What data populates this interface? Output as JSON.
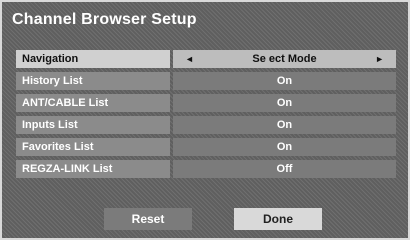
{
  "title": "Channel Browser Setup",
  "rows": [
    {
      "label": "Navigation",
      "value": "Se ect Mode",
      "left_arrow": "◄",
      "right_arrow": "►"
    },
    {
      "label": "History List",
      "value": "On"
    },
    {
      "label": "ANT/CABLE List",
      "value": "On"
    },
    {
      "label": "Inputs List",
      "value": "On"
    },
    {
      "label": "Favorites List",
      "value": "On"
    },
    {
      "label": "REGZA-LINK List",
      "value": "Off"
    }
  ],
  "buttons": {
    "reset": "Reset",
    "done": "Done"
  },
  "colors": {
    "background": "#5f5f5f",
    "row_label": "#8b8b8b",
    "row_value": "#7b7b7b",
    "highlight_label": "#d0d0d0",
    "highlight_value": "#bdbdbd",
    "done_button": "#d9d9d9"
  }
}
